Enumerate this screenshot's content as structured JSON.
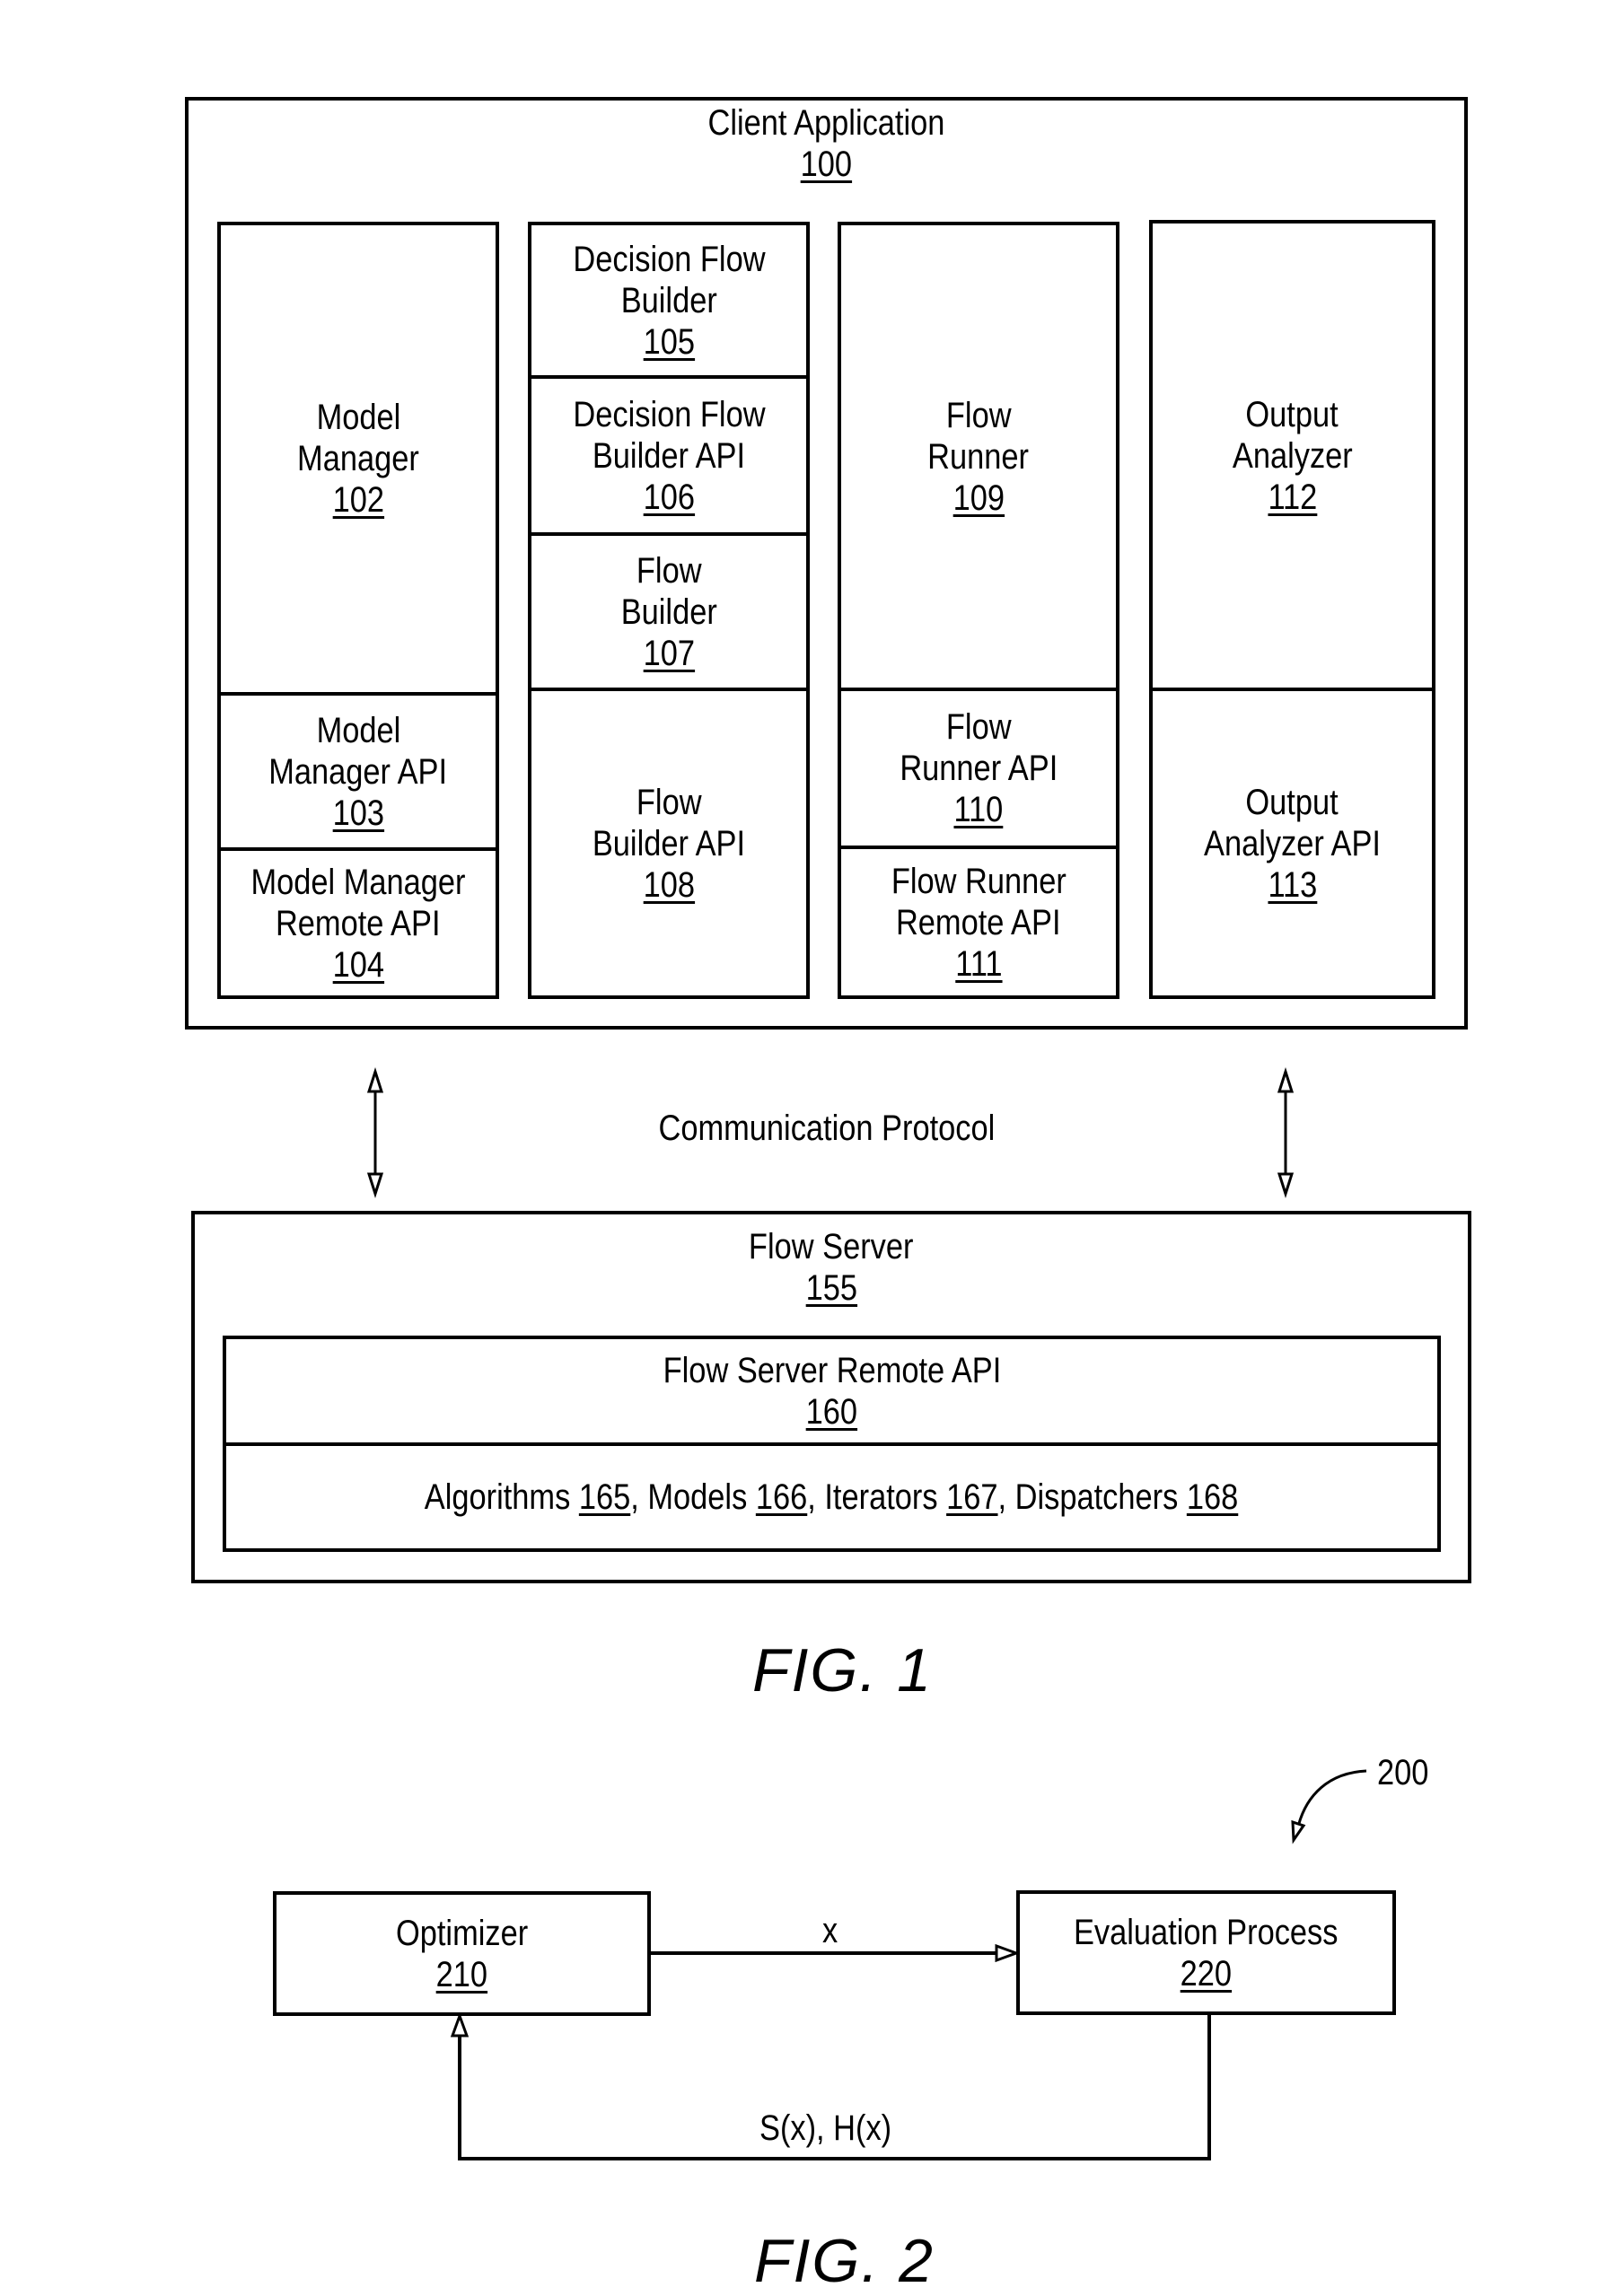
{
  "fig1": {
    "caption": "FIG. 1",
    "client_app": {
      "label": "Client Application",
      "ref": "100"
    },
    "columns": [
      {
        "cells": [
          {
            "lines": [
              "Model",
              "Manager"
            ],
            "ref": "102"
          },
          {
            "lines": [
              "Model",
              "Manager API"
            ],
            "ref": "103"
          },
          {
            "lines": [
              "Model Manager",
              "Remote API"
            ],
            "ref": "104"
          }
        ]
      },
      {
        "cells": [
          {
            "lines": [
              "Decision Flow",
              "Builder"
            ],
            "ref": "105"
          },
          {
            "lines": [
              "Decision Flow",
              "Builder API"
            ],
            "ref": "106"
          },
          {
            "lines": [
              "Flow",
              "Builder"
            ],
            "ref": "107"
          },
          {
            "lines": [
              "Flow",
              "Builder API"
            ],
            "ref": "108"
          }
        ]
      },
      {
        "cells": [
          {
            "lines": [
              "Flow",
              "Runner"
            ],
            "ref": "109"
          },
          {
            "lines": [
              "Flow",
              "Runner API"
            ],
            "ref": "110"
          },
          {
            "lines": [
              "Flow Runner",
              "Remote API"
            ],
            "ref": "111"
          }
        ]
      },
      {
        "cells": [
          {
            "lines": [
              "Output",
              "Analyzer"
            ],
            "ref": "112"
          },
          {
            "lines": [
              "Output",
              "Analyzer API"
            ],
            "ref": "113"
          }
        ]
      }
    ],
    "communication_protocol": "Communication Protocol",
    "flow_server": {
      "label": "Flow Server",
      "ref": "155"
    },
    "remote_api": {
      "label": "Flow Server Remote API",
      "ref": "160"
    },
    "components": [
      {
        "label": "Algorithms",
        "ref": "165",
        "sep": ", "
      },
      {
        "label": "Models",
        "ref": "166",
        "sep": ", "
      },
      {
        "label": "Iterators",
        "ref": "167",
        "sep": ", "
      },
      {
        "label": "Dispatchers",
        "ref": "168",
        "sep": ""
      }
    ]
  },
  "fig2": {
    "caption": "FIG. 2",
    "ref_marker": "200",
    "optimizer": {
      "label": "Optimizer",
      "ref": "210"
    },
    "evaluation": {
      "label": "Evaluation Process",
      "ref": "220"
    },
    "forward_label": "x",
    "feedback_label": "S(x), H(x)"
  }
}
